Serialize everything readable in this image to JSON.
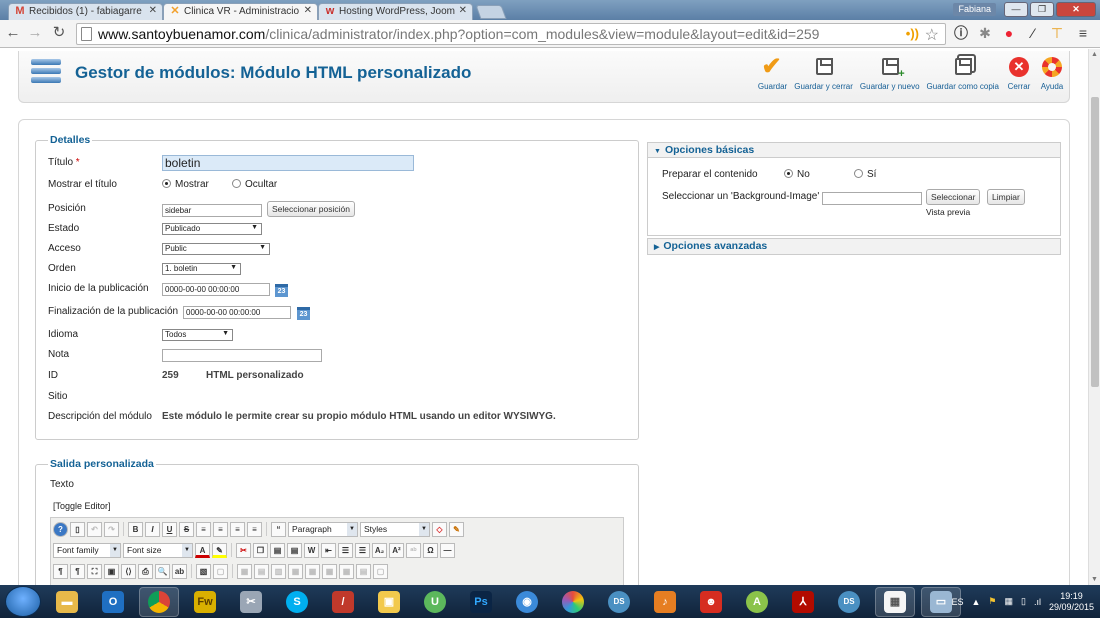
{
  "browser": {
    "tabs": [
      {
        "icon": "M",
        "icon_color": "#d44638",
        "label": "Recibidos (1) - fabiagarre"
      },
      {
        "icon": "✕",
        "icon_color": "#f3a02b",
        "label": "Clinica VR - Administracio"
      },
      {
        "icon": "w",
        "icon_color": "#c9302c",
        "label": "Hosting WordPress, Joom"
      }
    ],
    "user": "Fabiana",
    "url_host": "www.santoybuenamor.com",
    "url_path": "/clinica/administrator/index.php?option=com_modules&view=module&layout=edit&id=259"
  },
  "header": {
    "title": "Gestor de módulos: Módulo HTML personalizado",
    "buttons": {
      "save": "Guardar",
      "save_close": "Guardar y cerrar",
      "save_new": "Guardar y nuevo",
      "save_copy": "Guardar como copia",
      "close": "Cerrar",
      "help": "Ayuda"
    }
  },
  "details": {
    "legend": "Detalles",
    "title_label": "Título",
    "title_required": "*",
    "title_value": "boletin",
    "show_title_label": "Mostrar el título",
    "show_option": "Mostrar",
    "hide_option": "Ocultar",
    "position_label": "Posición",
    "position_value": "sidebar",
    "position_button": "Seleccionar posición",
    "state_label": "Estado",
    "state_value": "Publicado",
    "access_label": "Acceso",
    "access_value": "Public",
    "order_label": "Orden",
    "order_value": "1. boletin",
    "publish_up_label": "Inicio de la publicación",
    "publish_up_value": "0000-00-00 00:00:00",
    "publish_down_label": "Finalización de la publicación",
    "publish_down_value": "0000-00-00 00:00:00",
    "calendar_day": "23",
    "language_label": "Idioma",
    "language_value": "Todos",
    "note_label": "Nota",
    "note_value": "",
    "id_label": "ID",
    "id_value": "259",
    "id_type": "HTML personalizado",
    "site_label": "Sitio",
    "description_label": "Descripción del módulo",
    "description_value": "Este módulo le permite crear su propio módulo HTML usando un editor WYSIWYG."
  },
  "basic_options": {
    "heading": "Opciones básicas",
    "prepare_label": "Preparar el contenido",
    "no_option": "No",
    "yes_option": "Sí",
    "bg_label": "Seleccionar un 'Background-Image'",
    "bg_value": "",
    "select_button": "Seleccionar",
    "clear_button": "Limpiar",
    "preview_label": "Vista previa"
  },
  "advanced_options": {
    "heading": "Opciones avanzadas"
  },
  "custom_output": {
    "legend": "Salida personalizada",
    "text_label": "Texto",
    "toggle_editor": "[Toggle Editor]",
    "format_select": "Paragraph",
    "styles_select": "Styles",
    "font_family_select": "Font family",
    "font_size_select": "Font size"
  },
  "taskbar": {
    "language": "ES",
    "time": "19:19",
    "date": "29/09/2015"
  }
}
